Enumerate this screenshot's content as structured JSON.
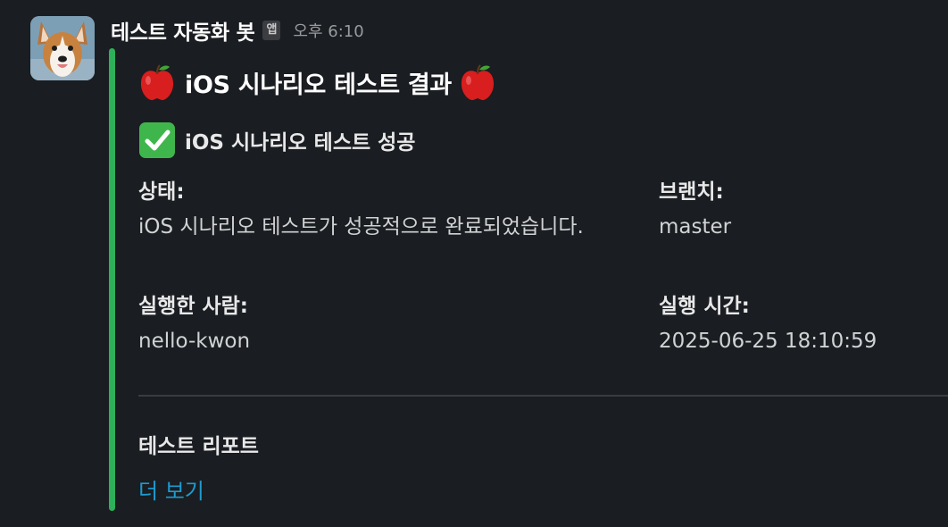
{
  "message": {
    "sender": "테스트 자동화 봇",
    "badge": "앱",
    "time": "오후 6:10",
    "avatar_icon": "dog-avatar-icon"
  },
  "attachment": {
    "bar_color": "#2eb05a",
    "title": "iOS 시나리오 테스트 결과",
    "title_icon": "red-apple-icon",
    "subtitle": "iOS 시나리오 테스트 성공",
    "subtitle_icon": "check-mark-button-icon",
    "fields": {
      "status_label": "상태:",
      "status_value": "iOS 시나리오 테스트가 성공적으로 완료되었습니다.",
      "branch_label": "브랜치:",
      "branch_value": "master",
      "runner_label": "실행한 사람:",
      "runner_value": "nello-kwon",
      "time_label": "실행 시간:",
      "time_value": "2025-06-25 18:10:59"
    },
    "report": {
      "label": "테스트 리포트",
      "link_text": "더 보기",
      "link_color": "#1d9bd1"
    }
  }
}
